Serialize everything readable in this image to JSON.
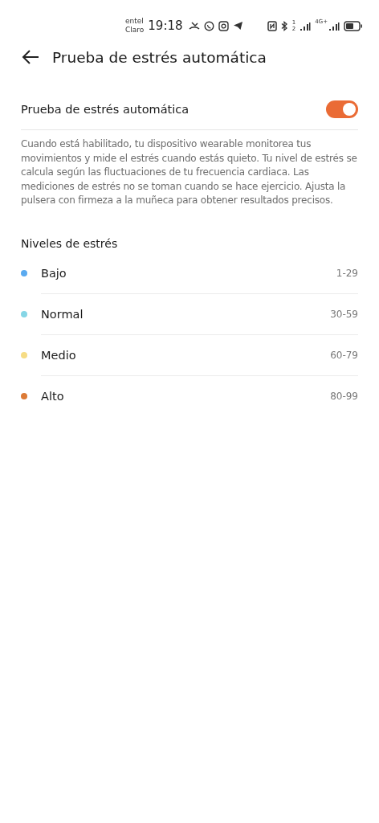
{
  "status_bar": {
    "carriers": [
      "entel",
      "Claro"
    ],
    "time": "19:18",
    "sim_1": "1",
    "sim_2": "2",
    "network": "4G+"
  },
  "header": {
    "title": "Prueba de estrés automática"
  },
  "setting": {
    "label": "Prueba de estrés automática",
    "on": true
  },
  "description": "Cuando está habilitado, tu dispositivo wearable monitorea tus movimientos y mide el estrés cuando estás quieto. Tu nivel de estrés se calcula según las fluctuaciones de tu frecuencia cardiaca. Las mediciones de estrés no se toman cuando se hace ejercicio. Ajusta la pulsera con firmeza a la muñeca para obtener resultados precisos.",
  "levels_title": "Niveles de estrés",
  "levels": [
    {
      "name": "Bajo",
      "range": "1-29",
      "color": "#5aaaf0"
    },
    {
      "name": "Normal",
      "range": "30-59",
      "color": "#86d6e6"
    },
    {
      "name": "Medio",
      "range": "60-79",
      "color": "#f6dc84"
    },
    {
      "name": "Alto",
      "range": "80-99",
      "color": "#dc7a36"
    }
  ]
}
